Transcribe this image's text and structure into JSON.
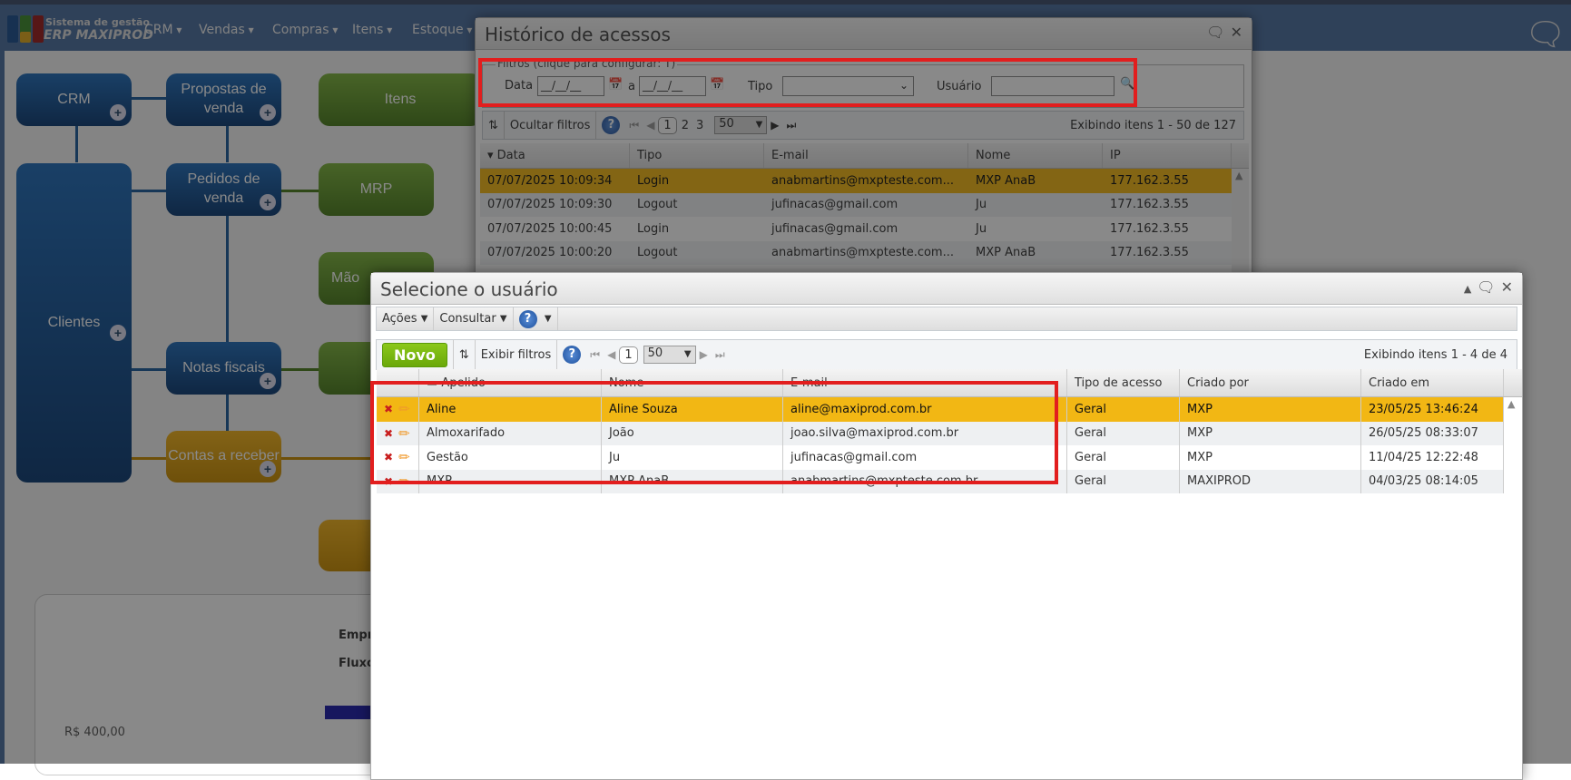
{
  "app": {
    "brand_line1": "Sistema de gestão",
    "brand_line2": "ERP MAXIPROD",
    "menu": [
      "CRM",
      "Vendas",
      "Compras",
      "Itens",
      "Estoque"
    ]
  },
  "diagram": {
    "crm": "CRM",
    "propostas": "Propostas de venda",
    "itens": "Itens",
    "clientes": "Clientes",
    "pedidos": "Pedidos de venda",
    "mrp": "MRP",
    "mao": "Mão",
    "notas": "Notas fiscais",
    "contas": "Contas a receber",
    "card_line1": "Empr",
    "card_line2": "Fluxo",
    "axis_label": "R$ 400,00"
  },
  "historico": {
    "title": "Histórico de acessos",
    "filters": {
      "legend": "Filtros (clique para configurar:",
      "legend_end": ")",
      "data_label": "Data",
      "date_from": "__/__/__",
      "sep": "a",
      "date_to": "__/__/__",
      "tipo_label": "Tipo",
      "tipo_value": "",
      "usuario_label": "Usuário",
      "usuario_value": ""
    },
    "toolbar": {
      "hide_filters": "Ocultar filtros",
      "pages": [
        "1",
        "2",
        "3"
      ],
      "page_size": "50",
      "status": "Exibindo itens 1 - 50 de 127"
    },
    "columns": [
      "Data",
      "Tipo",
      "E-mail",
      "Nome",
      "IP"
    ],
    "rows": [
      [
        "07/07/2025 10:09:34",
        "Login",
        "anabmartins@mxpteste.com...",
        "MXP AnaB",
        "177.162.3.55"
      ],
      [
        "07/07/2025 10:09:30",
        "Logout",
        "jufinacas@gmail.com",
        "Ju",
        "177.162.3.55"
      ],
      [
        "07/07/2025 10:00:45",
        "Login",
        "jufinacas@gmail.com",
        "Ju",
        "177.162.3.55"
      ],
      [
        "07/07/2025 10:00:20",
        "Logout",
        "anabmartins@mxpteste.com...",
        "MXP AnaB",
        "177.162.3.55"
      ]
    ]
  },
  "selecione": {
    "title": "Selecione o usuário",
    "menu": {
      "acoes": "Ações",
      "consultar": "Consultar"
    },
    "toolbar": {
      "novo": "Novo",
      "show_filters": "Exibir filtros",
      "page": "1",
      "page_size": "50",
      "status": "Exibindo itens 1 - 4 de 4"
    },
    "columns": [
      "Apelido",
      "Nome",
      "E-mail",
      "Tipo de acesso",
      "Criado por",
      "Criado em"
    ],
    "rows": [
      [
        "Aline",
        "Aline Souza",
        "aline@maxiprod.com.br",
        "Geral",
        "MXP",
        "23/05/25 13:46:24"
      ],
      [
        "Almoxarifado",
        "João",
        "joao.silva@maxiprod.com.br",
        "Geral",
        "MXP",
        "26/05/25 08:33:07"
      ],
      [
        "Gestão",
        "Ju",
        "jufinacas@gmail.com",
        "Geral",
        "MXP",
        "11/04/25 12:22:48"
      ],
      [
        "MXP",
        "MXP AnaB",
        "anabmartins@mxpteste.com.br",
        "Geral",
        "MAXIPROD",
        "04/03/25 08:14:05"
      ]
    ]
  },
  "colors": {
    "selected_row": "#f2b714",
    "highlight": "#e21e1e",
    "novo": "#7ab800"
  }
}
